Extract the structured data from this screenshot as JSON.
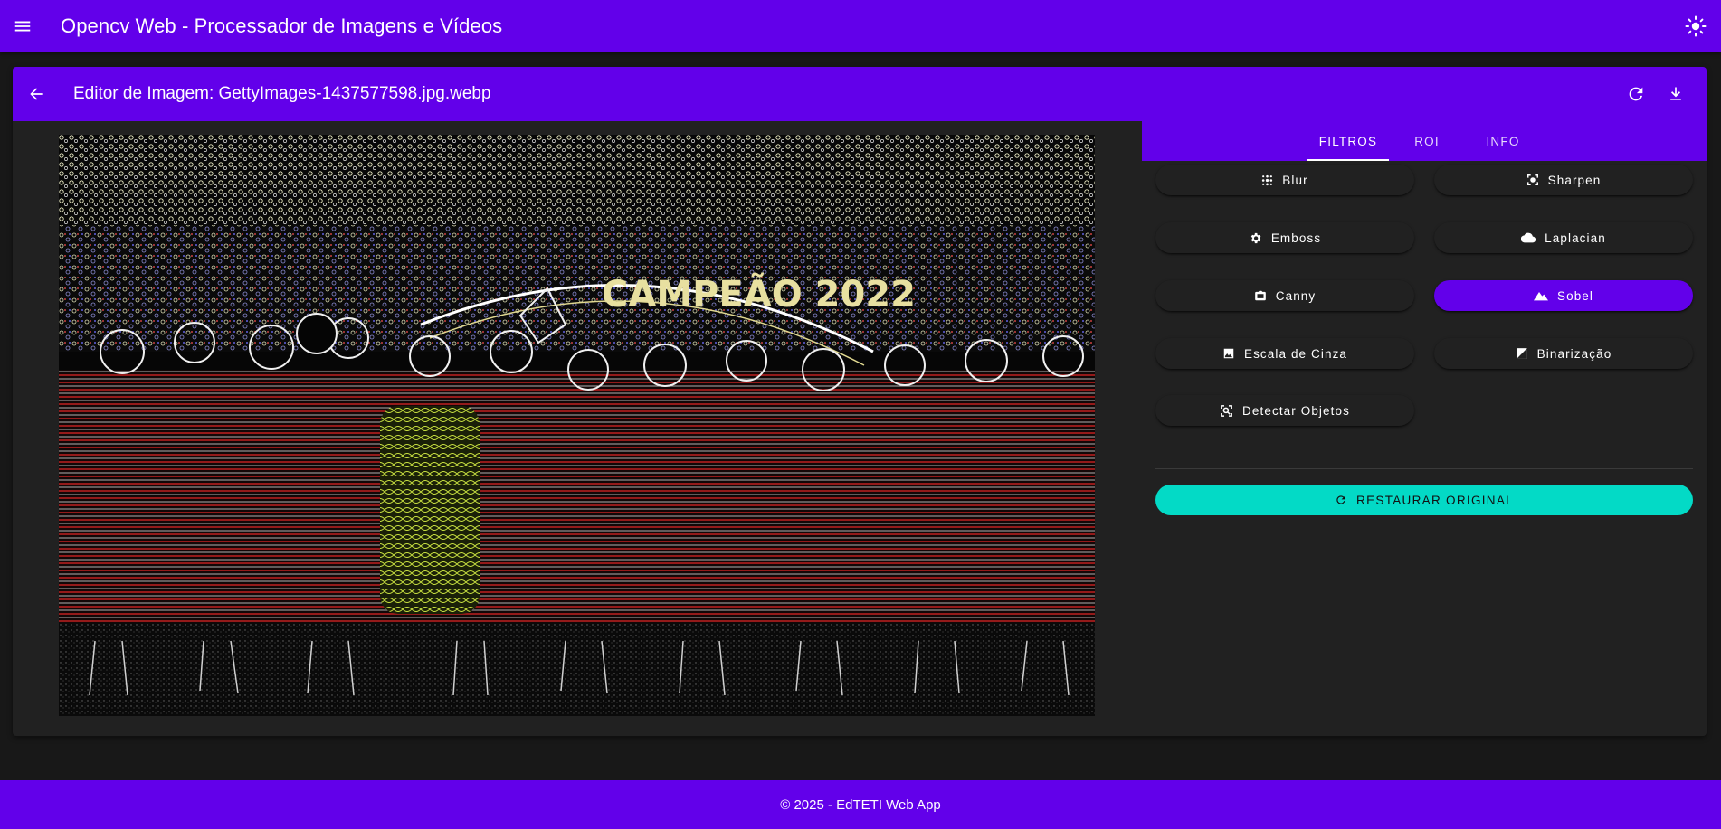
{
  "app": {
    "title": "Opencv Web - Processador de Imagens e Vídeos"
  },
  "editor": {
    "title": "Editor de Imagem: GettyImages-1437577598.jpg.webp",
    "image_text": "CAMPEÃO 2022"
  },
  "tabs": [
    {
      "label": "Filtros",
      "active": true
    },
    {
      "label": "ROI",
      "active": false
    },
    {
      "label": "Info",
      "active": false
    }
  ],
  "filters": [
    {
      "label": "Blur",
      "icon": "blur-icon",
      "active": false
    },
    {
      "label": "Sharpen",
      "icon": "sharpen-icon",
      "active": false
    },
    {
      "label": "Emboss",
      "icon": "gear-icon",
      "active": false
    },
    {
      "label": "Laplacian",
      "icon": "cloud-icon",
      "active": false
    },
    {
      "label": "Canny",
      "icon": "camera-icon",
      "active": false
    },
    {
      "label": "Sobel",
      "icon": "mountain-icon",
      "active": true
    },
    {
      "label": "Escala de Cinza",
      "icon": "image-icon",
      "active": false
    },
    {
      "label": "Binarização",
      "icon": "contrast-icon",
      "active": false
    },
    {
      "label": "Detectar Objetos",
      "icon": "object-detect-icon",
      "active": false
    }
  ],
  "restore_label": "Restaurar Original",
  "footer": "© 2025 - EdTETI Web App",
  "colors": {
    "primary": "#6200ea",
    "accent": "#03dac6",
    "background": "#181818",
    "surface": "#212121"
  }
}
